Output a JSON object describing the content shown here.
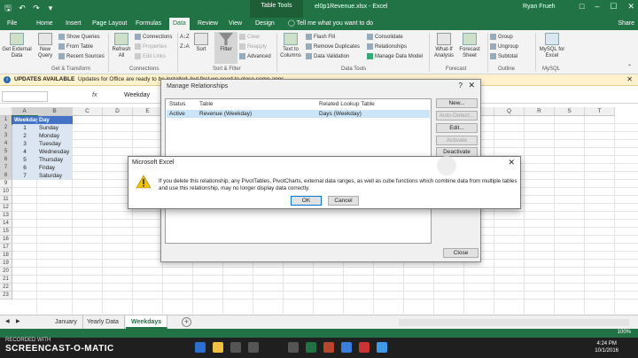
{
  "window": {
    "table_tools": "Table Tools",
    "title": "el0p1Revenue.xlsx - Excel",
    "user": "Ryan Frueh",
    "qat": [
      "save",
      "undo",
      "redo",
      "customize"
    ]
  },
  "tabs": [
    "File",
    "Home",
    "Insert",
    "Page Layout",
    "Formulas",
    "Data",
    "Review",
    "View",
    "Design"
  ],
  "active_tab": "Data",
  "tell_me": "Tell me what you want to do",
  "share": "Share",
  "ribbon": {
    "get_external": "Get External Data",
    "new_query": "New Query",
    "show_queries": "Show Queries",
    "from_table": "From Table",
    "recent_sources": "Recent Sources",
    "group_get_transform": "Get & Transform",
    "refresh_all": "Refresh All",
    "connections": "Connections",
    "properties": "Properties",
    "edit_links": "Edit Links",
    "group_connections": "Connections",
    "sort": "Sort",
    "filter": "Filter",
    "clear": "Clear",
    "reapply": "Reapply",
    "advanced": "Advanced",
    "group_sort_filter": "Sort & Filter",
    "text_to_columns": "Text to Columns",
    "flash_fill": "Flash Fill",
    "remove_duplicates": "Remove Duplicates",
    "data_validation": "Data Validation",
    "consolidate": "Consolidate",
    "relationships": "Relationships",
    "manage_data_model": "Manage Data Model",
    "group_data_tools": "Data Tools",
    "what_if": "What-If Analysis",
    "forecast_sheet": "Forecast Sheet",
    "group_forecast": "Forecast",
    "group_btn": "Group",
    "ungroup_btn": "Ungroup",
    "subtotal": "Subtotal",
    "group_outline": "Outline",
    "mysql": "MySQL for Excel",
    "group_mysql": "MySQL"
  },
  "update_bar": {
    "title": "UPDATES AVAILABLE",
    "text": "Updates for Office are ready to be installed, but first we need to close some apps."
  },
  "formula_bar": {
    "name_box": "",
    "fx": "fx",
    "value": "Weekday"
  },
  "grid": {
    "columns": [
      "A",
      "B",
      "C",
      "D",
      "E",
      "F",
      "G",
      "H",
      "I",
      "J",
      "K",
      "L",
      "M",
      "N",
      "O",
      "P",
      "Q",
      "R",
      "S",
      "T"
    ],
    "rows": [
      "1",
      "2",
      "3",
      "4",
      "5",
      "6",
      "7",
      "8",
      "9",
      "10",
      "11",
      "12",
      "13",
      "14",
      "15",
      "16",
      "17",
      "18",
      "19",
      "20",
      "21",
      "22",
      "23"
    ],
    "header": [
      "Weekday",
      "Day"
    ],
    "data": [
      [
        "1",
        "Sunday"
      ],
      [
        "2",
        "Monday"
      ],
      [
        "3",
        "Tuesday"
      ],
      [
        "4",
        "Wednesday"
      ],
      [
        "5",
        "Thursday"
      ],
      [
        "6",
        "Friday"
      ],
      [
        "7",
        "Saturday"
      ]
    ]
  },
  "sheets": [
    "January",
    "Yearly Data",
    "Weekdays"
  ],
  "active_sheet": "Weekdays",
  "manage_dialog": {
    "title": "Manage Relationships",
    "col_status": "Status",
    "col_table": "Table",
    "col_related": "Related Lookup Table",
    "row": {
      "status": "Active",
      "table": "Revenue (Weekday)",
      "related": "Days (Weekday)"
    },
    "btn_new": "New...",
    "btn_auto_detect": "Auto-Detect...",
    "btn_edit": "Edit...",
    "btn_activate": "Activate",
    "btn_deactivate": "Deactivate",
    "btn_close": "Close"
  },
  "alert": {
    "title": "Microsoft Excel",
    "message": "If you delete this relationship, any PivotTables, PivotCharts, external data ranges, as well as cube functions which combine data from multiple tables and use this relationship, may no longer display data correctly.",
    "ok": "OK",
    "cancel": "Cancel"
  },
  "status_bar": {
    "zoom": "100%"
  },
  "taskbar": {
    "recorded_with": "RECORDED WITH",
    "brand": "SCREENCAST-O-MATIC",
    "time": "4:24 PM",
    "date": "10/1/2016"
  },
  "colors": {
    "excel_green": "#217346",
    "table_header": "#4472c4",
    "table_band": "#dce6f2"
  }
}
